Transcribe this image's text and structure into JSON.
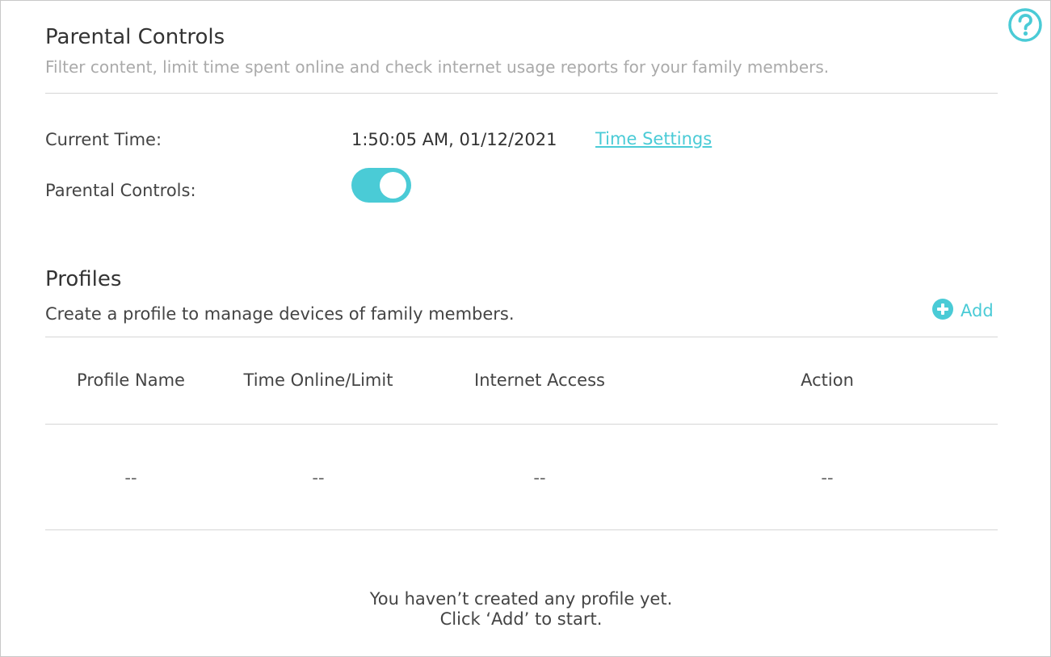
{
  "header": {
    "title": "Parental Controls",
    "subtitle": "Filter content, limit time spent online and check internet usage reports for your family members."
  },
  "settings": {
    "current_time_label": "Current Time:",
    "current_time_value": "1:50:05 AM, 01/12/2021",
    "time_settings_link": "Time Settings",
    "parental_controls_label": "Parental Controls:",
    "parental_controls_enabled": true
  },
  "profiles": {
    "title": "Profiles",
    "description": "Create a profile to manage devices of family members.",
    "add_label": "Add",
    "columns": [
      "Profile Name",
      "Time Online/Limit",
      "Internet Access",
      "Action"
    ],
    "row": [
      "--",
      "--",
      "--",
      "--"
    ],
    "empty_line1": "You haven’t created any profile yet.",
    "empty_line2": "Click ‘Add’ to start."
  },
  "colors": {
    "accent": "#4acbd6",
    "subtitle": "#aaaaaa",
    "divider": "#d6d6d6"
  },
  "icons": {
    "help": "help-question-icon",
    "add": "plus-circle-icon"
  }
}
